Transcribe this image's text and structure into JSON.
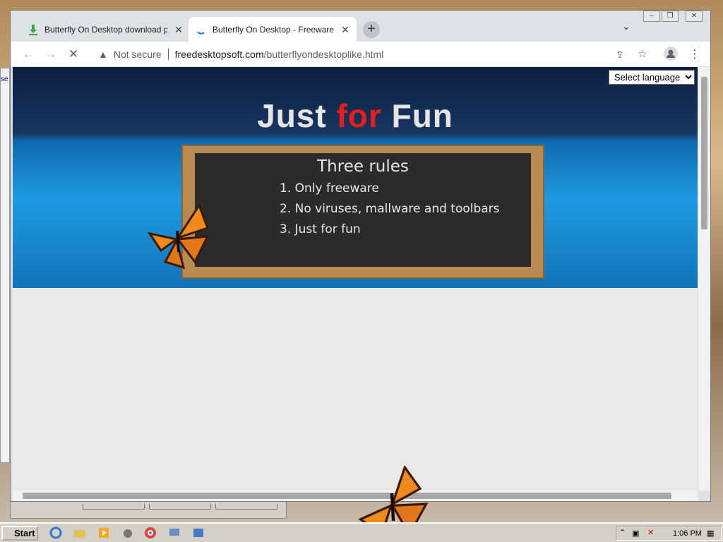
{
  "browser": {
    "tabs": [
      {
        "title": "Butterfly On Desktop download page",
        "close": "✕"
      },
      {
        "title": "Butterfly On Desktop - Freeware software",
        "close": "✕"
      }
    ],
    "new_tab_label": "+",
    "tab_dropdown": "⌄",
    "window_controls": {
      "minimize": "–",
      "restore": "❐",
      "close": "✕"
    },
    "nav": {
      "back": "←",
      "forward": "→",
      "stop": "✕"
    },
    "address": {
      "security_label": "Not secure",
      "host": "freedesktopsoft.com",
      "path": "/butterflyondesktoplike.html"
    },
    "toolbar_icons": [
      "share-icon",
      "star-icon",
      "profile-icon",
      "menu-icon"
    ]
  },
  "page": {
    "language_select": "Select language",
    "title": {
      "part1": "Just",
      "part2": "for",
      "part3": "Fun"
    },
    "chalkboard": {
      "heading": "Three rules",
      "rules": [
        "1. Only freeware",
        "2. No viruses, mallware and toolbars",
        "3. Just for fun"
      ]
    },
    "colors": {
      "title_red": "#e3201b",
      "banner_blue": "#1e9ae3"
    }
  },
  "taskbar": {
    "start_label": "Start",
    "clock": "1:06 PM"
  }
}
